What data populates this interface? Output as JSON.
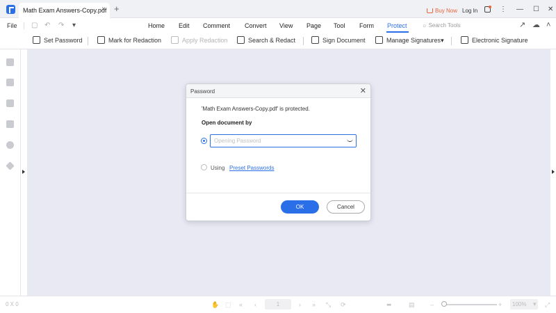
{
  "titlebar": {
    "tab_label": "Math Exam Answers-Copy.pdf",
    "tab_close": "×",
    "tab_add": "+",
    "buy_now": "Buy Now",
    "login": "Log In",
    "more": "⋮",
    "minimize": "—",
    "maximize": "☐",
    "close": "✕"
  },
  "menubar": {
    "file": "File",
    "items": [
      "Home",
      "Edit",
      "Comment",
      "Convert",
      "View",
      "Page",
      "Tool",
      "Form",
      "Protect"
    ],
    "active": "Protect",
    "search_tools": "Search Tools"
  },
  "toolbar": {
    "tools": [
      {
        "label": "Set Password",
        "enabled": true
      },
      {
        "label": "Mark for Redaction",
        "enabled": true
      },
      {
        "label": "Apply Redaction",
        "enabled": false
      },
      {
        "label": "Search & Redact",
        "enabled": true
      },
      {
        "label": "Sign Document",
        "enabled": true
      },
      {
        "label": "Manage Signatures",
        "enabled": true
      },
      {
        "label": "Electronic Signature",
        "enabled": true
      }
    ],
    "dropdown_caret": "▾"
  },
  "sidebar": {
    "icons": [
      "thumbnails-icon",
      "bookmark-icon",
      "comment-icon",
      "attachment-icon",
      "search-icon",
      "layers-icon"
    ]
  },
  "statusbar": {
    "coordinates": "0 X 0",
    "page_value": "1",
    "zoom_value": "100%"
  },
  "dialog": {
    "title": "Password",
    "close_glyph": "✕",
    "message": "'Math Exam Answers-Copy.pdf' is protected.",
    "subtitle": "Open document by",
    "password_placeholder": "Opening Password",
    "password_value": "",
    "using_label": "Using",
    "preset_link": "Preset Passwords",
    "ok_label": "OK",
    "cancel_label": "Cancel"
  },
  "colors": {
    "accent": "#2b6fe8",
    "buy_now": "#e8643c",
    "canvas": "#e8e9f3"
  }
}
